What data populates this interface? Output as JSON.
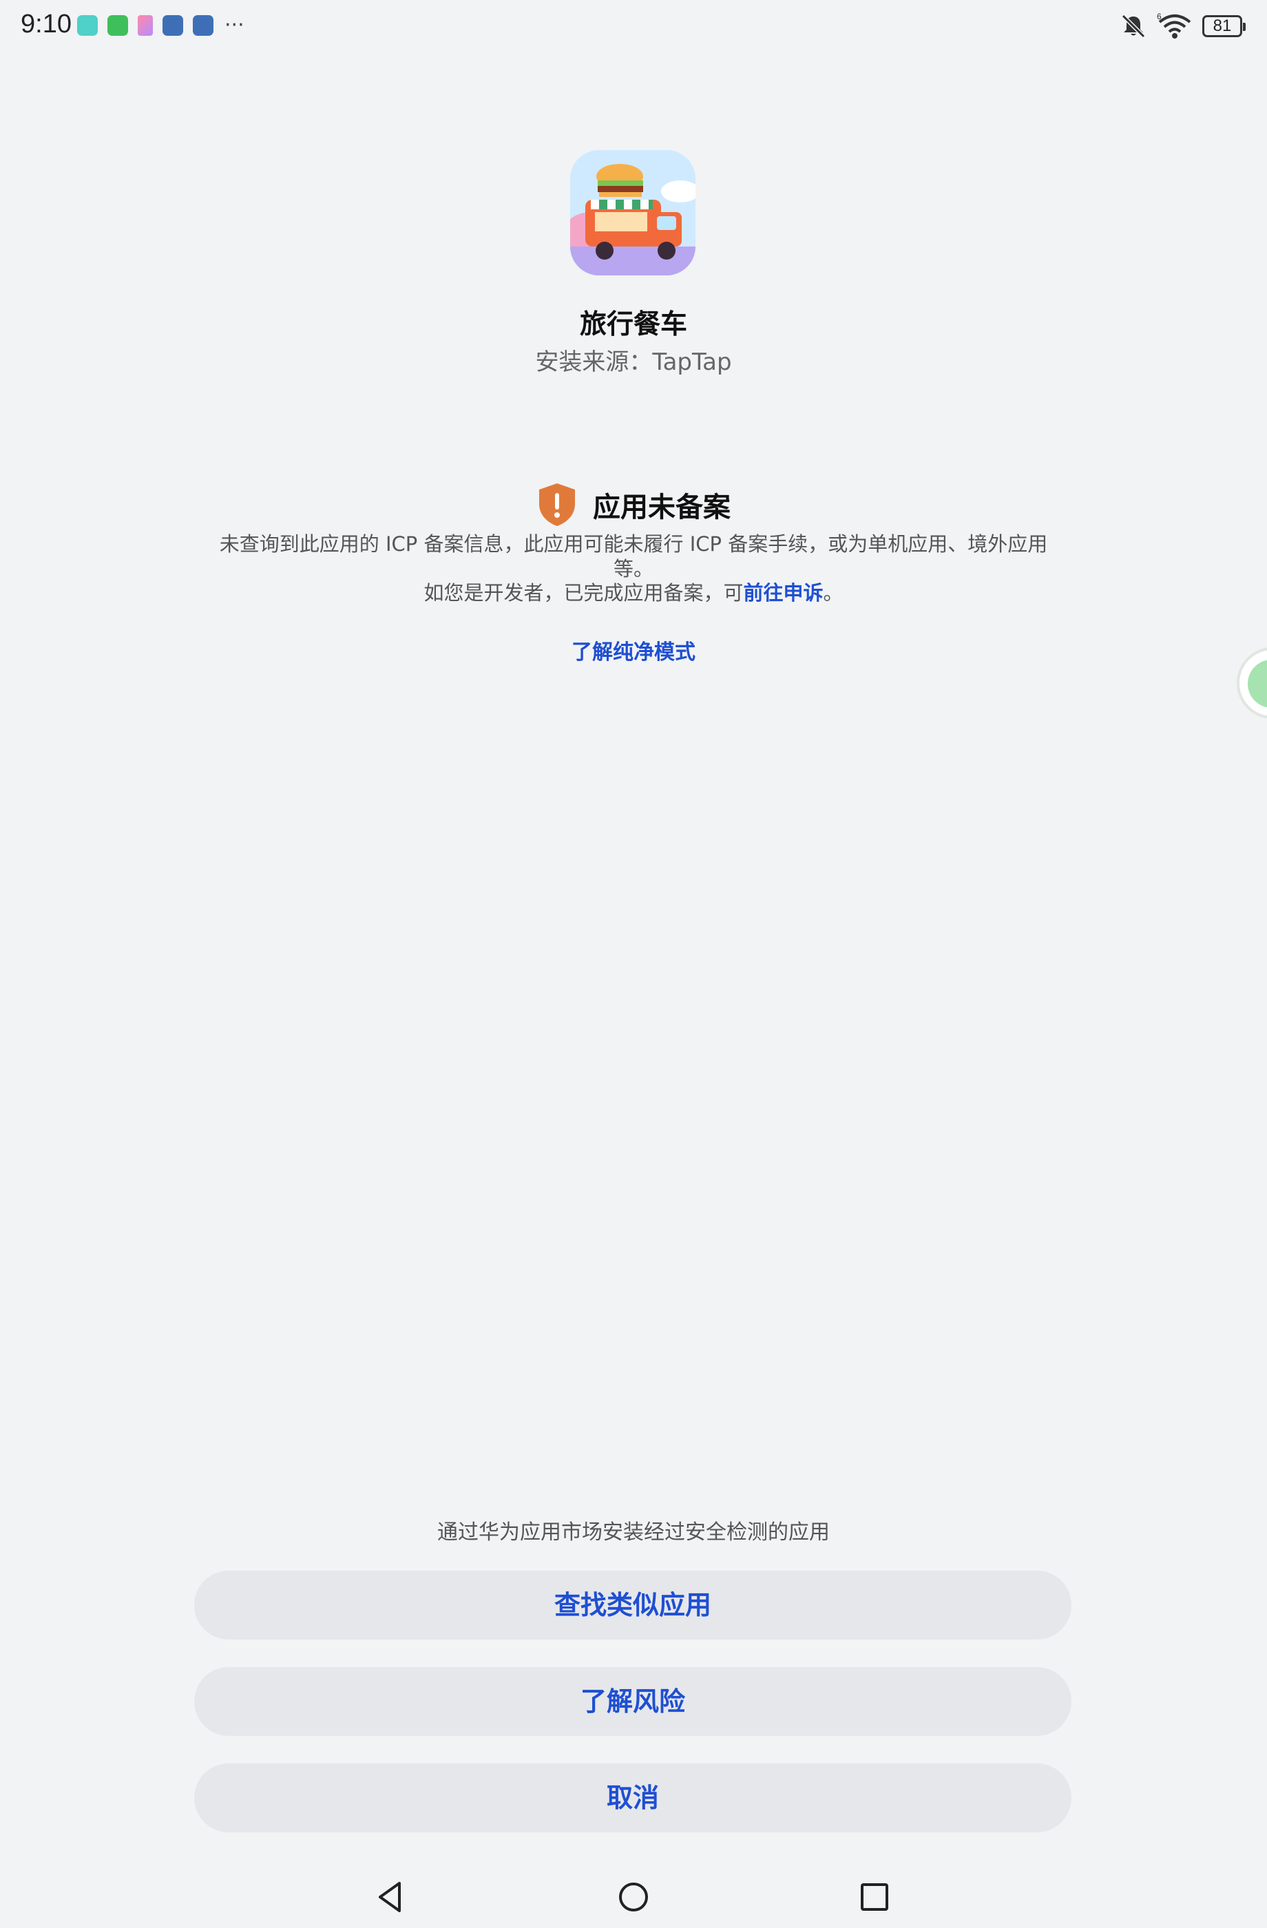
{
  "status_bar": {
    "time": "9:10",
    "battery_level": "81",
    "notification_icons": [
      "taptap-icon",
      "wechat-icon",
      "gift-box-icon",
      "gamepad-icon",
      "gamepad-icon"
    ],
    "more_indicator": "···",
    "signal_label": "6"
  },
  "app": {
    "name": "旅行餐车",
    "source": "安装来源：TapTap"
  },
  "warning": {
    "title": "应用未备案",
    "description": "未查询到此应用的 ICP 备案信息，此应用可能未履行 ICP 备案手续，或为单机应用、境外应用等。",
    "developer_prefix": "如您是开发者，已完成应用备案，可",
    "appeal_link": "前往申诉",
    "developer_suffix": "。",
    "pure_mode_link": "了解纯净模式",
    "shield_color": "#e07a3a"
  },
  "bottom": {
    "hint": "通过华为应用市场安装经过安全检测的应用",
    "find_similar_label": "查找类似应用",
    "learn_risk_label": "了解风险",
    "cancel_label": "取消"
  },
  "colors": {
    "background": "#f1f3f5",
    "accent": "#1f4fd2",
    "button_bg": "#e5e7eb"
  }
}
